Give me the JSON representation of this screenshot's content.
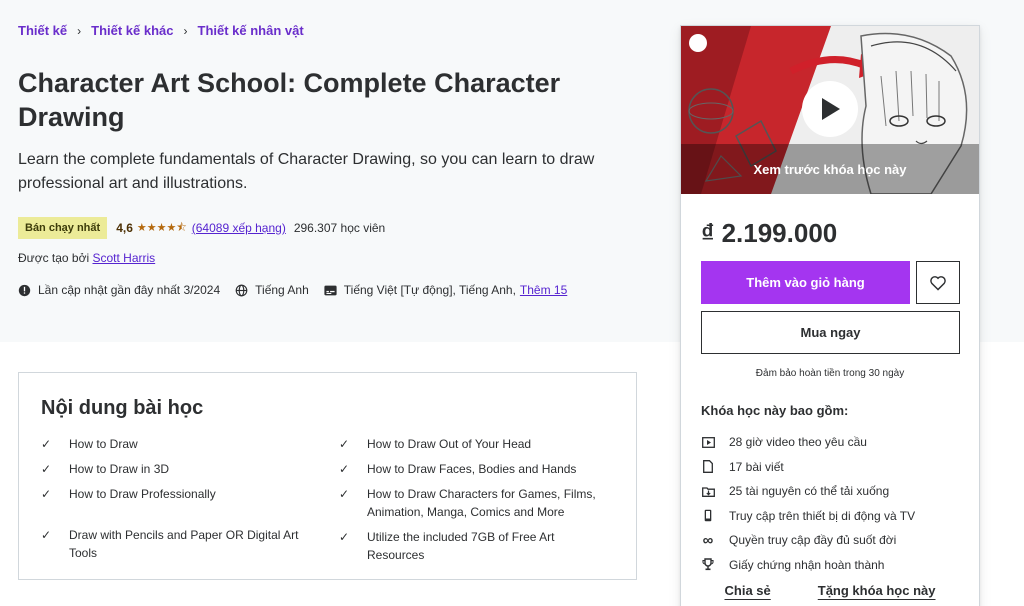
{
  "breadcrumb": [
    "Thiết kế",
    "Thiết kế khác",
    "Thiết kế nhân vật"
  ],
  "course": {
    "title": "Character Art School: Complete Character Drawing",
    "subtitle": "Learn the complete fundamentals of Character Drawing, so you can learn to draw professional art and illustrations.",
    "badge": "Bán chạy nhất",
    "rating": "4,6",
    "stars": "★★★★⯪",
    "ratings_count": "(64089 xếp hạng)",
    "students": "296.307 học viên",
    "created_by_label": "Được tạo bởi",
    "author": "Scott Harris",
    "last_updated": "Lần cập nhật gần đây nhất 3/2024",
    "language": "Tiếng Anh",
    "captions": "Tiếng Việt [Tự động], Tiếng Anh,",
    "more_captions": "Thêm 15"
  },
  "card": {
    "preview_caption": "Xem trước khóa học này",
    "price": "₫ 2.199.000",
    "add_to_cart": "Thêm vào giỏ hàng",
    "buy_now": "Mua ngay",
    "guarantee": "Đảm bảo hoàn tiền trong 30 ngày",
    "includes_title": "Khóa học này bao gồm:",
    "includes": [
      {
        "icon": "video-icon",
        "text": "28 giờ video theo yêu cầu"
      },
      {
        "icon": "file-icon",
        "text": "17 bài viết"
      },
      {
        "icon": "download-icon",
        "text": "25 tài nguyên có thể tải xuống"
      },
      {
        "icon": "mobile-icon",
        "text": "Truy cập trên thiết bị di động và TV"
      },
      {
        "icon": "infinity-icon",
        "text": "Quyền truy cập đầy đủ suốt đời"
      },
      {
        "icon": "trophy-icon",
        "text": "Giấy chứng nhận hoàn thành"
      }
    ],
    "share": "Chia sẻ",
    "gift": "Tặng khóa học này"
  },
  "learn": {
    "title": "Nội dung bài học",
    "left": [
      "How to Draw",
      "How to Draw in 3D",
      "How to Draw Professionally",
      "Draw with Pencils and Paper OR Digital Art Tools"
    ],
    "right": [
      "How to Draw Out of Your Head",
      "How to Draw Faces, Bodies and Hands",
      "How to Draw Characters for Games, Films, Animation, Manga, Comics and More",
      "Utilize the included 7GB of Free Art Resources"
    ]
  },
  "colors": {
    "accent": "#a435f0",
    "link": "#5624d0",
    "badge_bg": "#eceb98",
    "star": "#b4690e",
    "hero_bg": "#f7f9fa"
  }
}
